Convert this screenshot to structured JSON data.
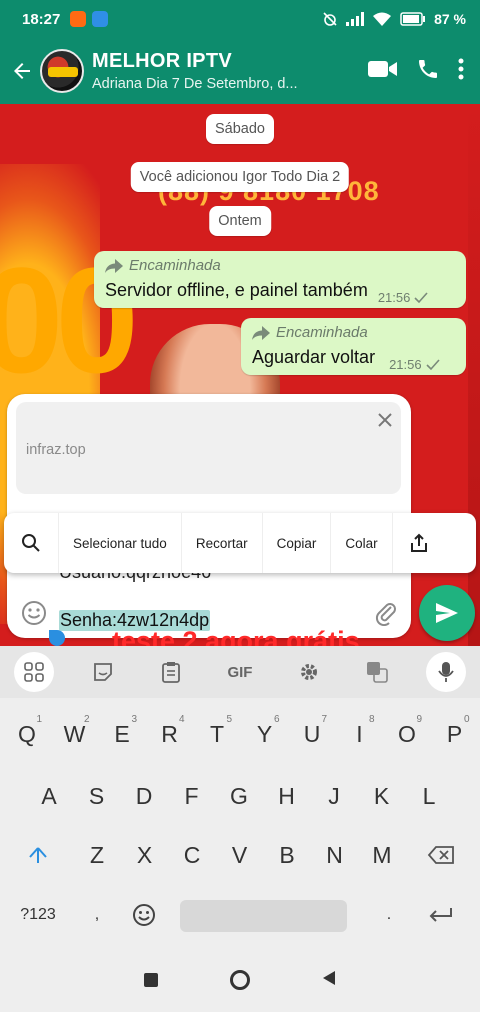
{
  "status_bar": {
    "time": "18:27",
    "battery": "87"
  },
  "header": {
    "title": "MELHOR IPTV",
    "subtitle": "Adriana Dia 7 De Setembro, d..."
  },
  "chat": {
    "chips": {
      "saturday": "Sábado",
      "added": "Você adicionou Igor Todo Dia 2",
      "yesterday": "Ontem"
    },
    "background_phone": "(88) 9 8180 1708",
    "background_big_number": "00",
    "messages": [
      {
        "forward_label": "Encaminhada",
        "text": "Servidor offline, e painel também",
        "time": "21:56"
      },
      {
        "forward_label": "Encaminhada",
        "text": "Aguardar voltar",
        "time": "21:56"
      }
    ]
  },
  "composer": {
    "preview_url": "infraz.top",
    "partial_line": "Usuario:qqrzhoe46",
    "input_text": "Senha:4zw12n4dp"
  },
  "context_menu": {
    "items": [
      "Selecionar tudo",
      "Recortar",
      "Copiar",
      "Colar"
    ]
  },
  "overlay_caption": "teste 2 agora grátis",
  "keyboard": {
    "toolbar_gif": "GIF",
    "row1": [
      {
        "k": "Q",
        "n": "1"
      },
      {
        "k": "W",
        "n": "2"
      },
      {
        "k": "E",
        "n": "3"
      },
      {
        "k": "R",
        "n": "4"
      },
      {
        "k": "T",
        "n": "5"
      },
      {
        "k": "Y",
        "n": "6"
      },
      {
        "k": "U",
        "n": "7"
      },
      {
        "k": "I",
        "n": "8"
      },
      {
        "k": "O",
        "n": "9"
      },
      {
        "k": "P",
        "n": "0"
      }
    ],
    "row2": [
      "A",
      "S",
      "D",
      "F",
      "G",
      "H",
      "J",
      "K",
      "L"
    ],
    "row3": [
      "Z",
      "X",
      "C",
      "V",
      "B",
      "N",
      "M"
    ],
    "symbols_label": "?123"
  }
}
